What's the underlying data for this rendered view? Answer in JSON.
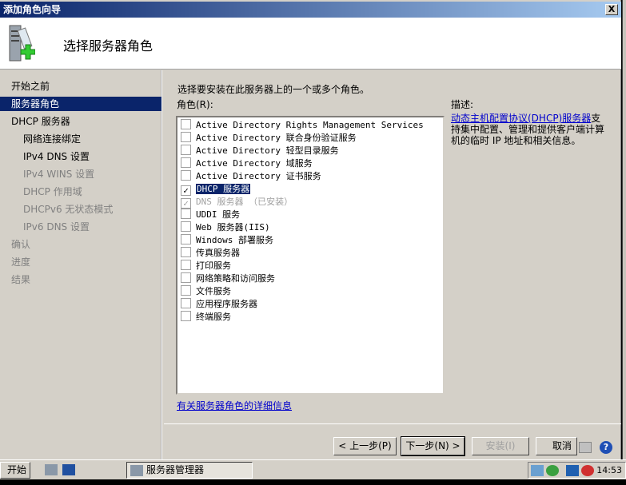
{
  "window": {
    "title": "添加角色向导",
    "close": "X"
  },
  "header": {
    "title": "选择服务器角色"
  },
  "nav": [
    {
      "label": "开始之前",
      "state": "normal"
    },
    {
      "label": "服务器角色",
      "state": "selected"
    },
    {
      "label": "DHCP 服务器",
      "state": "normal"
    },
    {
      "label": "网络连接绑定",
      "state": "sub"
    },
    {
      "label": "IPv4 DNS 设置",
      "state": "sub"
    },
    {
      "label": "IPv4 WINS 设置",
      "state": "sub-dim"
    },
    {
      "label": "DHCP 作用域",
      "state": "sub-dim"
    },
    {
      "label": "DHCPv6 无状态模式",
      "state": "sub-dim"
    },
    {
      "label": "IPv6 DNS 设置",
      "state": "sub-dim"
    },
    {
      "label": "确认",
      "state": "dim"
    },
    {
      "label": "进度",
      "state": "dim"
    },
    {
      "label": "结果",
      "state": "dim"
    }
  ],
  "main": {
    "intro": "选择要安装在此服务器上的一个或多个角色。",
    "roles_label": "角色(R):",
    "roles": [
      {
        "label": "Active Directory Rights Management Services",
        "checked": false
      },
      {
        "label": "Active Directory 联合身份验证服务",
        "checked": false
      },
      {
        "label": "Active Directory 轻型目录服务",
        "checked": false
      },
      {
        "label": "Active Directory 域服务",
        "checked": false
      },
      {
        "label": "Active Directory 证书服务",
        "checked": false
      },
      {
        "label": "DHCP 服务器",
        "checked": true,
        "selected": true
      },
      {
        "label": "DNS 服务器 （已安装）",
        "checked": true,
        "disabled": true
      },
      {
        "label": "UDDI 服务",
        "checked": false
      },
      {
        "label": "Web 服务器(IIS)",
        "checked": false
      },
      {
        "label": "Windows 部署服务",
        "checked": false
      },
      {
        "label": "传真服务器",
        "checked": false
      },
      {
        "label": "打印服务",
        "checked": false
      },
      {
        "label": "网络策略和访问服务",
        "checked": false
      },
      {
        "label": "文件服务",
        "checked": false
      },
      {
        "label": "应用程序服务器",
        "checked": false
      },
      {
        "label": "终端服务",
        "checked": false
      }
    ],
    "description_label": "描述:",
    "description_link": "动态主机配置协议(DHCP)服务器",
    "description_text": "支持集中配置、管理和提供客户端计算机的临时 IP 地址和相关信息。",
    "more_info_link": "有关服务器角色的详细信息"
  },
  "buttons": {
    "back": "< 上一步(P)",
    "next": "下一步(N) >",
    "install": "安装(I)",
    "cancel": "取消"
  },
  "taskbar": {
    "start": "开始",
    "task": "服务器管理器",
    "clock": "14:53"
  },
  "colors": {
    "selection": "#0a246a",
    "face": "#d4d0c8",
    "link": "#0000cc"
  }
}
